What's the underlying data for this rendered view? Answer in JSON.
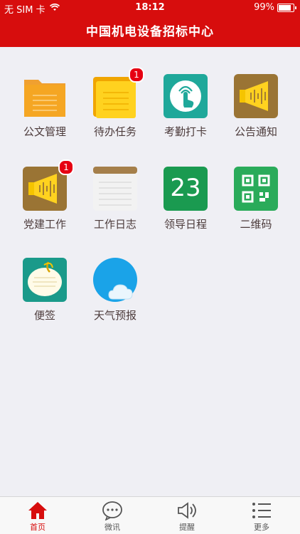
{
  "status": {
    "carrier": "无 SIM 卡",
    "time": "18:12",
    "battery": "99%"
  },
  "header": {
    "title": "中国机电设备招标中心"
  },
  "apps": [
    {
      "label": "公文管理",
      "icon": "folder-icon",
      "badge": ""
    },
    {
      "label": "待办任务",
      "icon": "task-folder-icon",
      "badge": "1"
    },
    {
      "label": "考勤打卡",
      "icon": "fingerprint-touch-icon",
      "badge": ""
    },
    {
      "label": "公告通知",
      "icon": "speaker-icon",
      "badge": ""
    },
    {
      "label": "党建工作",
      "icon": "speaker-icon",
      "badge": "1"
    },
    {
      "label": "工作日志",
      "icon": "notepad-icon",
      "badge": ""
    },
    {
      "label": "领导日程",
      "icon": "calendar-icon",
      "badge": "",
      "calendar_day": "23"
    },
    {
      "label": "二维码",
      "icon": "qrcode-icon",
      "badge": ""
    },
    {
      "label": "便签",
      "icon": "sticky-note-icon",
      "badge": ""
    },
    {
      "label": "天气预报",
      "icon": "weather-icon",
      "badge": ""
    }
  ],
  "tabs": [
    {
      "label": "首页",
      "icon": "home-icon",
      "active": true
    },
    {
      "label": "微讯",
      "icon": "chat-icon",
      "active": false
    },
    {
      "label": "提醒",
      "icon": "speaker-icon",
      "active": false
    },
    {
      "label": "更多",
      "icon": "list-icon",
      "active": false
    }
  ],
  "colors": {
    "header": "#d70d0d",
    "background": "#efeff4",
    "badge": "#e60012",
    "active_tab": "#d70d0d"
  }
}
